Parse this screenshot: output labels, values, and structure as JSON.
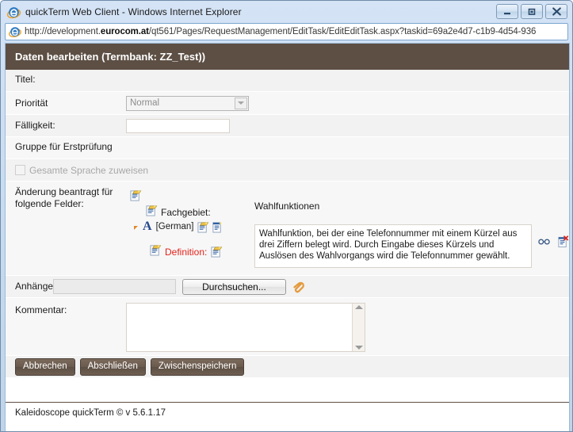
{
  "window": {
    "title": "quickTerm Web Client - Windows Internet Explorer",
    "icon": "ie-logo-icon",
    "buttons": {
      "minimize": "minimize-button",
      "maximize": "maximize-button",
      "close": "close-button"
    }
  },
  "address_bar": {
    "url_prefix": "http://development.",
    "url_domain": "eurocom.at",
    "url_suffix": "/qt561/Pages/RequestManagement/EditTask/EditEditTask.aspx?taskid=69a2e4d7-c1b9-4d54-936"
  },
  "form": {
    "header": "Daten bearbeiten (Termbank: ZZ_Test))",
    "rows": {
      "titel_label": "Titel:",
      "prioritaet_label": "Priorität",
      "prioritaet_value": "Normal",
      "faelligkeit_label": "Fälligkeit:",
      "faelligkeit_value": "",
      "gruppe_label": "Gruppe für Erstprüfung",
      "checkbox_label": "Gesamte Sprache zuweisen",
      "aenderung_label_line1": "Änderung beantragt für",
      "aenderung_label_line2": "folgende Felder:",
      "anhaenge_label": "Anhänge:",
      "kommentar_label": "Kommentar:",
      "kommentar_value": ""
    },
    "tree": {
      "fachgebiet_label": "Fachgebiet:",
      "fachgebiet_value": "Wahlfunktionen",
      "language_label": "[German]",
      "definition_label": "Definition:",
      "definition_value": "Wahlfunktion, bei der eine Telefonnummer mit einem Kürzel aus drei Ziffern belegt wird. Durch Eingabe dieses Kürzels und Auslösen des Wahlvorgangs wird die Telefonnummer gewählt."
    },
    "attachments": {
      "browse_button": "Durchsuchen...",
      "file_value": ""
    },
    "buttons": {
      "cancel": "Abbrechen",
      "complete": "Abschließen",
      "save_draft": "Zwischenspeichern"
    }
  },
  "footer": {
    "text": "Kaleidoscope quickTerm © v 5.6.1.17"
  },
  "colors": {
    "header_brown": "#5d4f44",
    "definition_red": "#e2231a",
    "chrome_blue": "#c6d9ee",
    "link_blue": "#24478f"
  }
}
